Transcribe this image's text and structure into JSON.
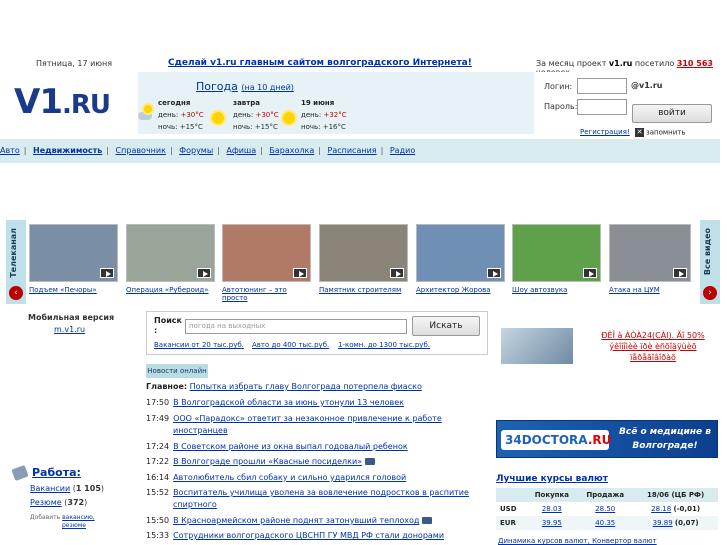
{
  "top": {
    "date": "Пятница, 17 июня",
    "slogan": "Сделай v1.ru главным сайтом волгоградского Интернета!",
    "stats_prefix": "За месяц проект",
    "stats_site": "v1.ru",
    "stats_mid": "посетило",
    "stats_count": "310 563",
    "stats_suffix": "человек"
  },
  "logo": {
    "main": "V1",
    "dot_ru": ".RU"
  },
  "weather": {
    "title": "Погода",
    "subtitle": "(на 10 дней)",
    "days": [
      {
        "name": "сегодня",
        "day_label": "день:",
        "day_temp": "+30°C",
        "night_label": "ночь:",
        "night_temp": "+15°C",
        "icon": "partly-cloudy-icon"
      },
      {
        "name": "завтра",
        "day_label": "день:",
        "day_temp": "+30°C",
        "night_label": "ночь:",
        "night_temp": "+15°C",
        "icon": "sun-icon"
      },
      {
        "name": "19 июня",
        "day_label": "день:",
        "day_temp": "+32°C",
        "night_label": "ночь:",
        "night_temp": "+16°C",
        "icon": "sun-icon"
      }
    ]
  },
  "login": {
    "login_label": "Логин:",
    "login_suffix": "@v1.ru",
    "password_label": "Пароль:",
    "button": "войти",
    "register": "Регистрация!",
    "remember": "запомнить"
  },
  "nav": [
    "Авто",
    "Недвижимость",
    "Справочник",
    "Форумы",
    "Афиша",
    "Барахолка",
    "Расписания",
    "Радио"
  ],
  "strip": {
    "left_label": "Телеканал",
    "right_label": "Все видео",
    "items": [
      {
        "caption": "Подъем «Печоры»",
        "bg": "#7a8fa5"
      },
      {
        "caption": "Операция «Рубероид»",
        "bg": "#9aa59a"
      },
      {
        "caption": "Автотюнинг – это просто",
        "bg": "#b07a66"
      },
      {
        "caption": "Памятник строителям",
        "bg": "#8a8378"
      },
      {
        "caption": "Архитектор Жорова",
        "bg": "#6f8fb5"
      },
      {
        "caption": "Шоу автозвука",
        "bg": "#5fa04a"
      },
      {
        "caption": "Атака на ЦУМ",
        "bg": "#8a8f95"
      }
    ]
  },
  "mobile": {
    "label": "Мобильная версия",
    "link": "m.v1.ru"
  },
  "search": {
    "label": "Поиск :",
    "placeholder": "погода на выходных",
    "button": "Искать",
    "hints": [
      "Вакансии от 20 тыс.руб.",
      "Авто до 400 тыс.руб.",
      "1-комн. до 1300 тыс.руб."
    ]
  },
  "news": {
    "tab": "Новости онлайн",
    "main_label": "Главное:",
    "main_headline": "Попытка избрать главу Волгограда потерпела фиаско",
    "items": [
      {
        "time": "17:50",
        "headline": "В Волгоградской области за июнь утонули 13 человек"
      },
      {
        "time": "17:49",
        "headline": "ООО «Парадокс» ответит за незаконное привлечение к работе",
        "cont": "иностранцев"
      },
      {
        "time": "17:24",
        "headline": "В Советском районе из окна выпал годовалый ребенок"
      },
      {
        "time": "17:22",
        "headline": "В Волгограде прошли «Квасные посиделки»",
        "icon": "camera-icon"
      },
      {
        "time": "16:14",
        "headline": "Автолюбитель сбил собаку и сильно ударился головой"
      },
      {
        "time": "15:52",
        "headline": "Воспитатель училища уволена за вовлечение подростков в распитие",
        "cont": "спиртного"
      },
      {
        "time": "15:50",
        "headline": "В Красноармейском районе поднят затонувший теплоход",
        "icon": "people-icon"
      },
      {
        "time": "15:33",
        "headline": "Сотрудники волгоградского ЦВСНП ГУ МВД РФ стали донорами"
      }
    ]
  },
  "jobs": {
    "title": "Работа:",
    "vacancies_label": "Вакансии",
    "vacancies_count": "1 105",
    "resume_label": "Резюме",
    "resume_count": "372",
    "add_prefix": "Добавить",
    "add_vacancy": "вакансию,",
    "add_resume": "резюме"
  },
  "ad": {
    "text": "ÐÈÎ à ÀÒÀ24(CÀl). Ãî 50% ýêîíîìèè ïðè èñõîäÿùèõ ïåðåãîâîðàõ"
  },
  "doctor": {
    "logo_a": "34DOCTORA",
    "logo_b": ".RU",
    "slogan": "Всё о медицине в Волгограде!"
  },
  "rates": {
    "title": "Лучшие курсы валют",
    "headers": [
      "",
      "Покупка",
      "Продажа",
      "18/06 (ЦБ РФ)"
    ],
    "rows": [
      {
        "cur": "USD",
        "buy": "28.03",
        "sell": "28.50",
        "cb": "28.18",
        "delta": "(-0,01)"
      },
      {
        "cur": "EUR",
        "buy": "39.95",
        "sell": "40.35",
        "cb": "39.89",
        "delta": "(0,07)"
      }
    ],
    "links": "Динамика курсов валют, Конвертор валют"
  }
}
